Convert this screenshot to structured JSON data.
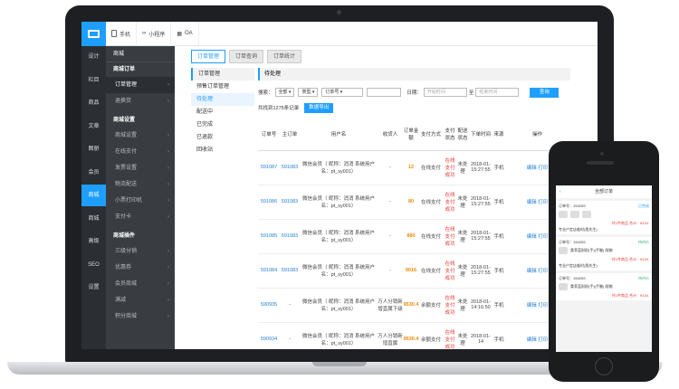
{
  "topbar": {
    "items": [
      {
        "label": "手机"
      },
      {
        "label": "小程序"
      },
      {
        "label": "OA"
      }
    ]
  },
  "left_nav": [
    "设计",
    "栏目",
    "商品",
    "文章",
    "图册",
    "会员",
    "商城",
    "商城",
    "高级",
    "SEO",
    "设置"
  ],
  "menu": {
    "header": "商城",
    "group1": "商城订单",
    "group1_items": [
      "订单管理",
      "退换货"
    ],
    "group2": "商城设置",
    "group2_items": [
      "商城设置",
      "在线支付",
      "发票设置",
      "物流配送",
      "小票打印机",
      "支付卡"
    ],
    "group3": "商城插件",
    "group3_items": [
      "三级分销",
      "优惠券",
      "会员商城",
      "满减",
      "积分商城"
    ]
  },
  "tabs": [
    "订单管理",
    "订单查询",
    "订单统计"
  ],
  "sub_menu": {
    "header": "订单管理",
    "items": [
      "预售订单管理",
      "待处理",
      "配送中",
      "已完成",
      "已退款",
      "回收站"
    ]
  },
  "panel": {
    "title": "待处理",
    "search_label": "搜索：",
    "select_all": "全部",
    "select_type": "类型",
    "select_order": "订单号",
    "date_label": "日期：",
    "date_start": "开始时间",
    "date_to": "至",
    "date_end": "结束时间",
    "query_button": "查询",
    "count_text": "共找到1275条记录",
    "export_button": "数据导出"
  },
  "table": {
    "headers": [
      "订单号",
      "主订单",
      "用户名",
      "收货人",
      "订单金额",
      "支付方式",
      "支付状态",
      "配送状态",
      "下单时间",
      "来源",
      "操作"
    ],
    "rows": [
      {
        "order": "591087",
        "main": "591083",
        "user": "微信会员（ 昵称：消消 系统用户名：pt_sy001）",
        "receiver": "-",
        "amount": "12",
        "pay": "在线支付",
        "pay_status": "在线支付成功",
        "ship": "未处理",
        "time": "2018-01-15:27:55",
        "source": "手机",
        "op": "编辑 打印"
      },
      {
        "order": "591086",
        "main": "591083",
        "user": "微信会员（ 昵称：消消 系统用户名：pt_sy001）",
        "receiver": "-",
        "amount": "80",
        "pay": "在线支付",
        "pay_status": "在线支付成功",
        "ship": "未处理",
        "time": "2018-01-15:27:55",
        "source": "手机",
        "op": "编辑 打印"
      },
      {
        "order": "591085",
        "main": "591083",
        "user": "微信会员（ 昵称：消消 系统用户名：pt_sy001）",
        "receiver": "-",
        "amount": "880",
        "pay": "在线支付",
        "pay_status": "在线支付成功",
        "ship": "未处理",
        "time": "2018-01-15:27:55",
        "source": "手机",
        "op": "编辑 打印"
      },
      {
        "order": "591084",
        "main": "591083",
        "user": "微信会员（ 昵称：消消 系统用户名：pt_sy001）",
        "receiver": "-",
        "amount": "9016",
        "pay": "在线支付",
        "pay_status": "在线支付成功",
        "ship": "未处理",
        "time": "2018-01-15:27:55",
        "source": "手机",
        "op": "编辑 打印"
      },
      {
        "order": "590935",
        "main": "-",
        "user": "微信会员（ 昵称：消消 系统用户名：pt_sy001）",
        "receiver": "万人分销新增直属下级",
        "amount": "9530.4",
        "pay": "余额支付",
        "pay_status": "在线支付成功",
        "ship": "未处理",
        "time": "2018-01-14:16:50",
        "source": "手机",
        "op": "编辑 打印"
      },
      {
        "order": "590934",
        "main": "-",
        "user": "微信会员（ 昵称：消消 系统用户名：pt_sy001）",
        "receiver": "万人分销新增直属",
        "amount": "9530.4",
        "pay": "余额支付",
        "pay_status": "在线支付成功",
        "ship": "未处理",
        "time": "2018-01-14",
        "source": "手机",
        "op": "编辑 打印"
      }
    ]
  },
  "phone": {
    "title": "全部订单",
    "cards": [
      {
        "order": "订单号：19420S",
        "status": "已完成",
        "total": "共1件商品 合计：¥134.",
        "shop": "专业户定店临时(我先生)"
      },
      {
        "order": "订单号：19420S",
        "status": "待评价",
        "item": "桑菲蓝耐耐(手)(手腕) 耐腕",
        "total": "共1件商品 合计：¥134.",
        "shop": "专业户定店临时(我先生)"
      },
      {
        "order": "订单号：19420S",
        "status": "待评价",
        "item": "桑菲蓝耐耐(手)(手腕) 耐腕",
        "total": "共1件商品 合计：¥134.",
        "shop": ""
      }
    ]
  },
  "colors": {
    "accent": "#1e9fff",
    "dark_nav": "#2b2e33",
    "menu": "#393d42",
    "amount": "#f08a00",
    "status": "#e53935"
  }
}
